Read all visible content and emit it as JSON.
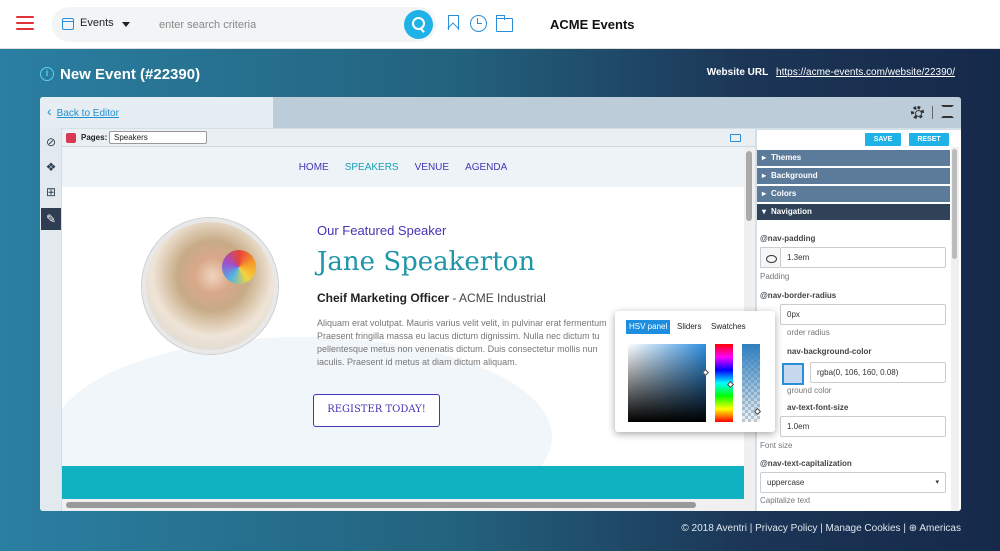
{
  "topbar": {
    "selector_label": "Events",
    "search_placeholder": "enter search criteria",
    "app_title": "ACME Events"
  },
  "page": {
    "title": "New Event (#22390)",
    "website_label": "Website URL",
    "website_url": "https://acme-events.com/website/22390/"
  },
  "editor": {
    "back_label": "Back to Editor",
    "pages_label": "Pages:",
    "pages_value": "Speakers"
  },
  "site": {
    "nav": [
      "HOME",
      "SPEAKERS",
      "VENUE",
      "AGENDA"
    ],
    "active_nav": "SPEAKERS",
    "featured": "Our Featured Speaker",
    "name": "Jane Speakerton",
    "role": "Cheif Marketing Officer",
    "company": " - ACME Industrial",
    "bio": "Aliquam erat volutpat. Mauris varius velit velit, in pulvinar erat fermentum Praesent fringilla massa eu lacus dictum dignissim. Nulla nec dictum tu pellentesque metus non venenatis dictum. Duis consectetur mollis nun iaculis. Praesent id metus at diam dictum aliquam.",
    "register": "REGISTER TODAY!"
  },
  "props": {
    "save": "SAVE",
    "reset": "RESET",
    "sections": [
      "Themes",
      "Background",
      "Colors",
      "Navigation"
    ],
    "open_section": "Navigation",
    "nav_padding": {
      "label": "@nav-padding",
      "value": "1.3em",
      "desc": "Padding"
    },
    "nav_radius": {
      "label": "@nav-border-radius",
      "value": "0px",
      "desc": "order radius"
    },
    "nav_bg": {
      "label": "nav-background-color",
      "value": "rgba(0, 106, 160, 0.08)",
      "desc": "ground color"
    },
    "nav_font": {
      "label": "av-text-font-size",
      "value": "1.0em",
      "desc": "Font size"
    },
    "nav_caps": {
      "label": "@nav-text-capitalization",
      "value": "uppercase",
      "desc": "Capitalize text"
    }
  },
  "picker": {
    "tabs": [
      "HSV panel",
      "Sliders",
      "Swatches"
    ],
    "active_tab": "HSV panel"
  },
  "footer": "© 2018 Aventri | Privacy Policy | Manage Cookies | ⊕ Americas",
  "colors": {
    "accent": "#1eb2e6",
    "brand_red": "#e0323a",
    "teal": "#1e95a8",
    "purple": "#4435b6"
  }
}
